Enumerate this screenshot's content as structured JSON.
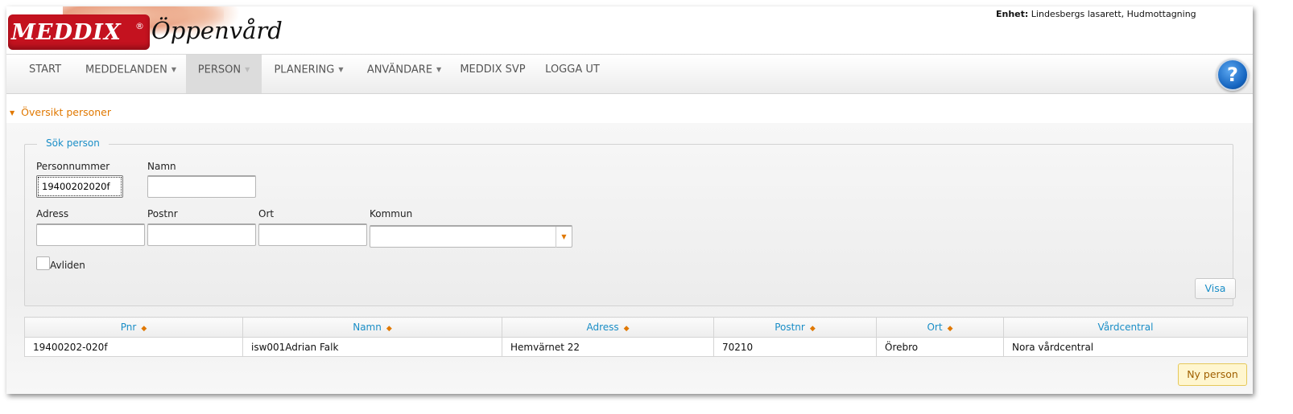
{
  "header": {
    "logo_text": "MEDDIX",
    "logo_reg": "®",
    "app_name": "Öppenvård",
    "unit_label": "Enhet:",
    "unit_value": "Lindesbergs lasarett, Hudmottagning"
  },
  "nav": {
    "items": [
      {
        "label": "START",
        "dropdown": false
      },
      {
        "label": "MEDDELANDEN",
        "dropdown": true
      },
      {
        "label": "PERSON",
        "dropdown": true,
        "active": true
      },
      {
        "label": "PLANERING",
        "dropdown": true
      },
      {
        "label": "ANVÄNDARE",
        "dropdown": true
      },
      {
        "label": "MEDDIX SVP",
        "dropdown": false
      },
      {
        "label": "LOGGA UT",
        "dropdown": false
      }
    ],
    "help_label": "?"
  },
  "section": {
    "title": "Översikt personer"
  },
  "search": {
    "legend": "Sök person",
    "fields": {
      "personnummer": {
        "label": "Personnummer",
        "value": "19400202020f"
      },
      "namn": {
        "label": "Namn",
        "value": ""
      },
      "adress": {
        "label": "Adress",
        "value": ""
      },
      "postnr": {
        "label": "Postnr",
        "value": ""
      },
      "ort": {
        "label": "Ort",
        "value": ""
      },
      "kommun": {
        "label": "Kommun",
        "value": ""
      }
    },
    "avliden_label": "Avliden",
    "avliden_checked": false,
    "visa_button": "Visa"
  },
  "table": {
    "columns": [
      "Pnr",
      "Namn",
      "Adress",
      "Postnr",
      "Ort",
      "Vårdcentral"
    ],
    "rows": [
      [
        "19400202-020f",
        "isw001Adrian Falk",
        "Hemvärnet 22",
        "70210",
        "Örebro",
        "Nora vårdcentral"
      ]
    ]
  },
  "ny_person_button": "Ny person",
  "colors": {
    "accent_blue": "#1a8ec7",
    "accent_orange": "#e07800",
    "brand_red": "#c4121f"
  }
}
